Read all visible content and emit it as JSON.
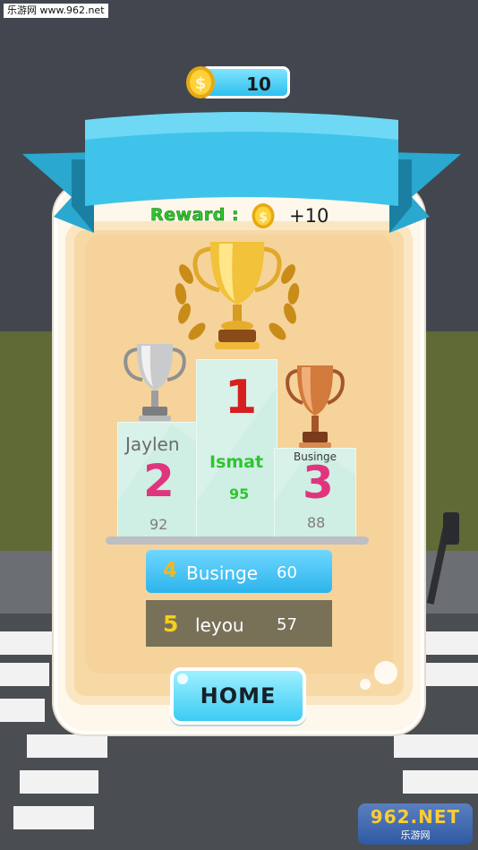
{
  "watermark": {
    "top": "乐游网 www.962.net",
    "bottom_logo": "962.NET",
    "bottom_sub": "乐游网"
  },
  "coins": {
    "count": "10"
  },
  "reward": {
    "label": "Reward :",
    "amount": "+10"
  },
  "podium": [
    {
      "rank": "2",
      "name": "Jaylen",
      "score": "92",
      "trophy": "silver-trophy-icon"
    },
    {
      "rank": "1",
      "name": "Ismat",
      "score": "95",
      "trophy": "gold-trophy-icon"
    },
    {
      "rank": "3",
      "name": "Businge",
      "score": "88",
      "trophy": "bronze-trophy-icon"
    }
  ],
  "leaderboard": [
    {
      "rank": "4",
      "name": "Businge",
      "score": "60"
    },
    {
      "rank": "5",
      "name": "leyou",
      "score": "57"
    }
  ],
  "home_button": {
    "label": "HOME"
  },
  "colors": {
    "accent": "#2cb4ec",
    "reward_green": "#2ec62e",
    "rank_pink": "#e0357e",
    "rank_red": "#d61f1f",
    "rank_gold": "#f0b81c"
  }
}
